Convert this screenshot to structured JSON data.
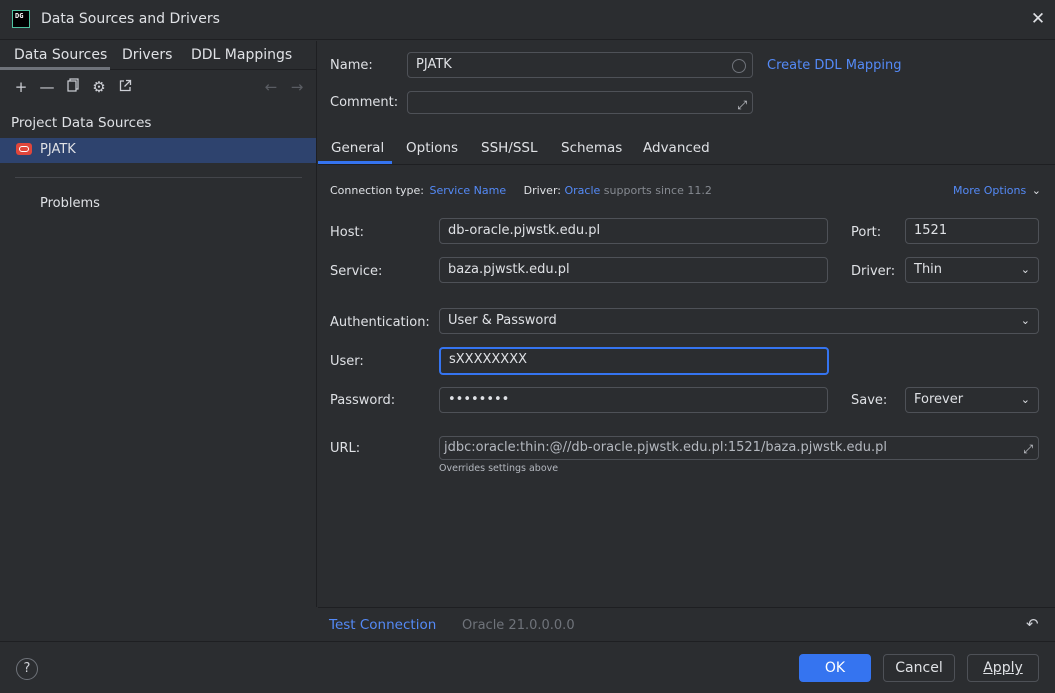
{
  "window": {
    "title": "Data Sources and Drivers",
    "app_icon_text": "DG"
  },
  "left": {
    "tabs": [
      "Data Sources",
      "Drivers",
      "DDL Mappings"
    ],
    "section_label": "Project Data Sources",
    "selected_item": "PJATK",
    "problems": "Problems"
  },
  "form": {
    "name_label": "Name:",
    "name_value": "PJATK",
    "create_ddl_link": "Create DDL Mapping",
    "comment_label": "Comment:",
    "comment_value": ""
  },
  "tabs": [
    "General",
    "Options",
    "SSH/SSL",
    "Schemas",
    "Advanced"
  ],
  "general": {
    "conn_type_label": "Connection type:",
    "conn_type_value": "Service Name",
    "driver_label": "Driver:",
    "driver_value": "Oracle",
    "driver_note": "supports since 11.2",
    "more_options": "More Options",
    "host_label": "Host:",
    "host_value": "db-oracle.pjwstk.edu.pl",
    "port_label": "Port:",
    "port_value": "1521",
    "service_label": "Service:",
    "service_value": "baza.pjwstk.edu.pl",
    "driver_sel_label": "Driver:",
    "driver_sel_value": "Thin",
    "auth_label": "Authentication:",
    "auth_value": "User & Password",
    "user_label": "User:",
    "user_value": "sXXXXXXXX",
    "password_label": "Password:",
    "password_value": "••••••••",
    "save_label": "Save:",
    "save_value": "Forever",
    "url_label": "URL:",
    "url_value": "jdbc:oracle:thin:@//db-oracle.pjwstk.edu.pl:1521/baza.pjwstk.edu.pl",
    "url_note": "Overrides settings above"
  },
  "status": {
    "test_connection": "Test Connection",
    "version": "Oracle 21.0.0.0.0"
  },
  "buttons": {
    "help": "?",
    "ok": "OK",
    "cancel": "Cancel",
    "apply": "Apply"
  },
  "colors": {
    "accent": "#3574f0",
    "link": "#548af7",
    "selection": "#2e436e",
    "oracle": "#e0463b"
  }
}
